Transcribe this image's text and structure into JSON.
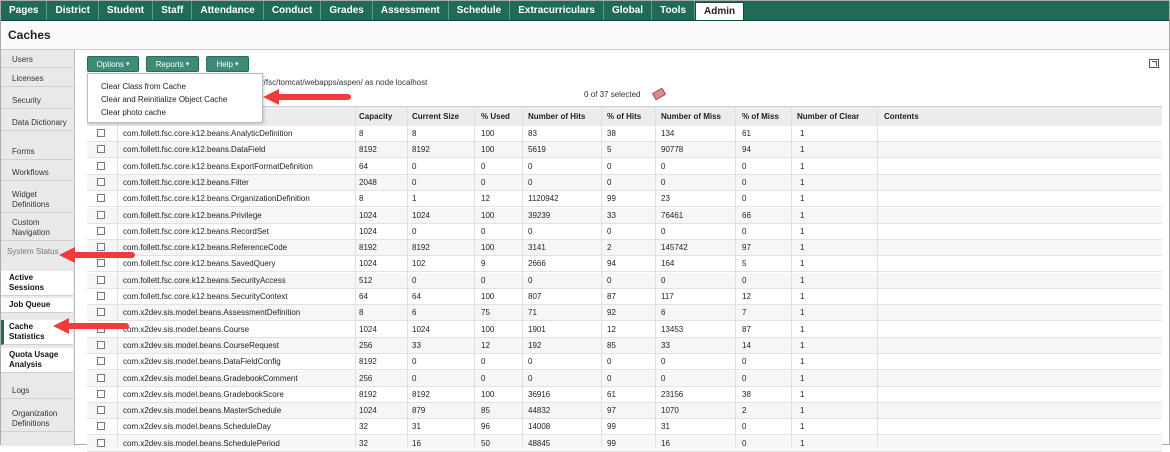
{
  "nav": {
    "tabs": [
      "Pages",
      "District",
      "Student",
      "Staff",
      "Attendance",
      "Conduct",
      "Grades",
      "Assessment",
      "Schedule",
      "Extracurriculars",
      "Global",
      "Tools",
      "Admin"
    ],
    "active": "Admin"
  },
  "page": {
    "title": "Caches"
  },
  "sidebar": {
    "items": [
      "Users",
      "Licenses",
      "Security",
      "Data Dictionary",
      "Forms",
      "Workflows",
      "Widget Definitions",
      "Custom Navigation"
    ],
    "group": "System Status",
    "subitems": [
      "Active Sessions",
      "Job Queue",
      "Cache Statistics",
      "Quota Usage Analysis"
    ],
    "tail": [
      "Logs",
      "Organization Definitions"
    ],
    "selected": "Cache Statistics"
  },
  "toolbar": {
    "options": "Options",
    "reports": "Reports",
    "help": "Help"
  },
  "options_menu": [
    "Clear Class from Cache",
    "Clear and Reinitialize Object Cache",
    "Clear photo cache"
  ],
  "path_text": "r/fsc/tomcat/webapps/aspen/ as node localhost",
  "selection": "0 of 37 selected",
  "table": {
    "columns": [
      "Capacity",
      "Current Size",
      "% Used",
      "Number of Hits",
      "% of Hits",
      "Number of Miss",
      "% of Miss",
      "Number of Clear",
      "Contents"
    ],
    "rows": [
      [
        "com.follett.fsc.core.k12.beans.AnalyticDefinition",
        "8",
        "8",
        "100",
        "83",
        "38",
        "134",
        "61",
        "1"
      ],
      [
        "com.follett.fsc.core.k12.beans.DataField",
        "8192",
        "8192",
        "100",
        "5619",
        "5",
        "90778",
        "94",
        "1"
      ],
      [
        "com.follett.fsc.core.k12.beans.ExportFormatDefinition",
        "64",
        "0",
        "0",
        "0",
        "0",
        "0",
        "0",
        "1"
      ],
      [
        "com.follett.fsc.core.k12.beans.Filter",
        "2048",
        "0",
        "0",
        "0",
        "0",
        "0",
        "0",
        "1"
      ],
      [
        "com.follett.fsc.core.k12.beans.OrganizationDefinition",
        "8",
        "1",
        "12",
        "1120942",
        "99",
        "23",
        "0",
        "1"
      ],
      [
        "com.follett.fsc.core.k12.beans.Privilege",
        "1024",
        "1024",
        "100",
        "39239",
        "33",
        "76461",
        "66",
        "1"
      ],
      [
        "com.follett.fsc.core.k12.beans.RecordSet",
        "1024",
        "0",
        "0",
        "0",
        "0",
        "0",
        "0",
        "1"
      ],
      [
        "com.follett.fsc.core.k12.beans.ReferenceCode",
        "8192",
        "8192",
        "100",
        "3141",
        "2",
        "145742",
        "97",
        "1"
      ],
      [
        "com.follett.fsc.core.k12.beans.SavedQuery",
        "1024",
        "102",
        "9",
        "2666",
        "94",
        "164",
        "5",
        "1"
      ],
      [
        "com.follett.fsc.core.k12.beans.SecurityAccess",
        "512",
        "0",
        "0",
        "0",
        "0",
        "0",
        "0",
        "1"
      ],
      [
        "com.follett.fsc.core.k12.beans.SecurityContext",
        "64",
        "64",
        "100",
        "807",
        "87",
        "117",
        "12",
        "1"
      ],
      [
        "com.x2dev.sis.model.beans.AssessmentDefinition",
        "8",
        "6",
        "75",
        "71",
        "92",
        "6",
        "7",
        "1"
      ],
      [
        "com.x2dev.sis.model.beans.Course",
        "1024",
        "1024",
        "100",
        "1901",
        "12",
        "13453",
        "87",
        "1"
      ],
      [
        "com.x2dev.sis.model.beans.CourseRequest",
        "256",
        "33",
        "12",
        "192",
        "85",
        "33",
        "14",
        "1"
      ],
      [
        "com.x2dev.sis.model.beans.DataFieldConfig",
        "8192",
        "0",
        "0",
        "0",
        "0",
        "0",
        "0",
        "1"
      ],
      [
        "com.x2dev.sis.model.beans.GradebookComment",
        "256",
        "0",
        "0",
        "0",
        "0",
        "0",
        "0",
        "1"
      ],
      [
        "com.x2dev.sis.model.beans.GradebookScore",
        "8192",
        "8192",
        "100",
        "36916",
        "61",
        "23156",
        "38",
        "1"
      ],
      [
        "com.x2dev.sis.model.beans.MasterSchedule",
        "1024",
        "879",
        "85",
        "44832",
        "97",
        "1070",
        "2",
        "1"
      ],
      [
        "com.x2dev.sis.model.beans.ScheduleDay",
        "32",
        "31",
        "96",
        "14008",
        "99",
        "31",
        "0",
        "1"
      ],
      [
        "com.x2dev.sis.model.beans.SchedulePeriod",
        "32",
        "16",
        "50",
        "48845",
        "99",
        "16",
        "0",
        "1"
      ]
    ]
  },
  "colors": {
    "nav_bg": "#1f6b57",
    "button": "#3d8c77",
    "arrow": "#ef3b3b"
  }
}
